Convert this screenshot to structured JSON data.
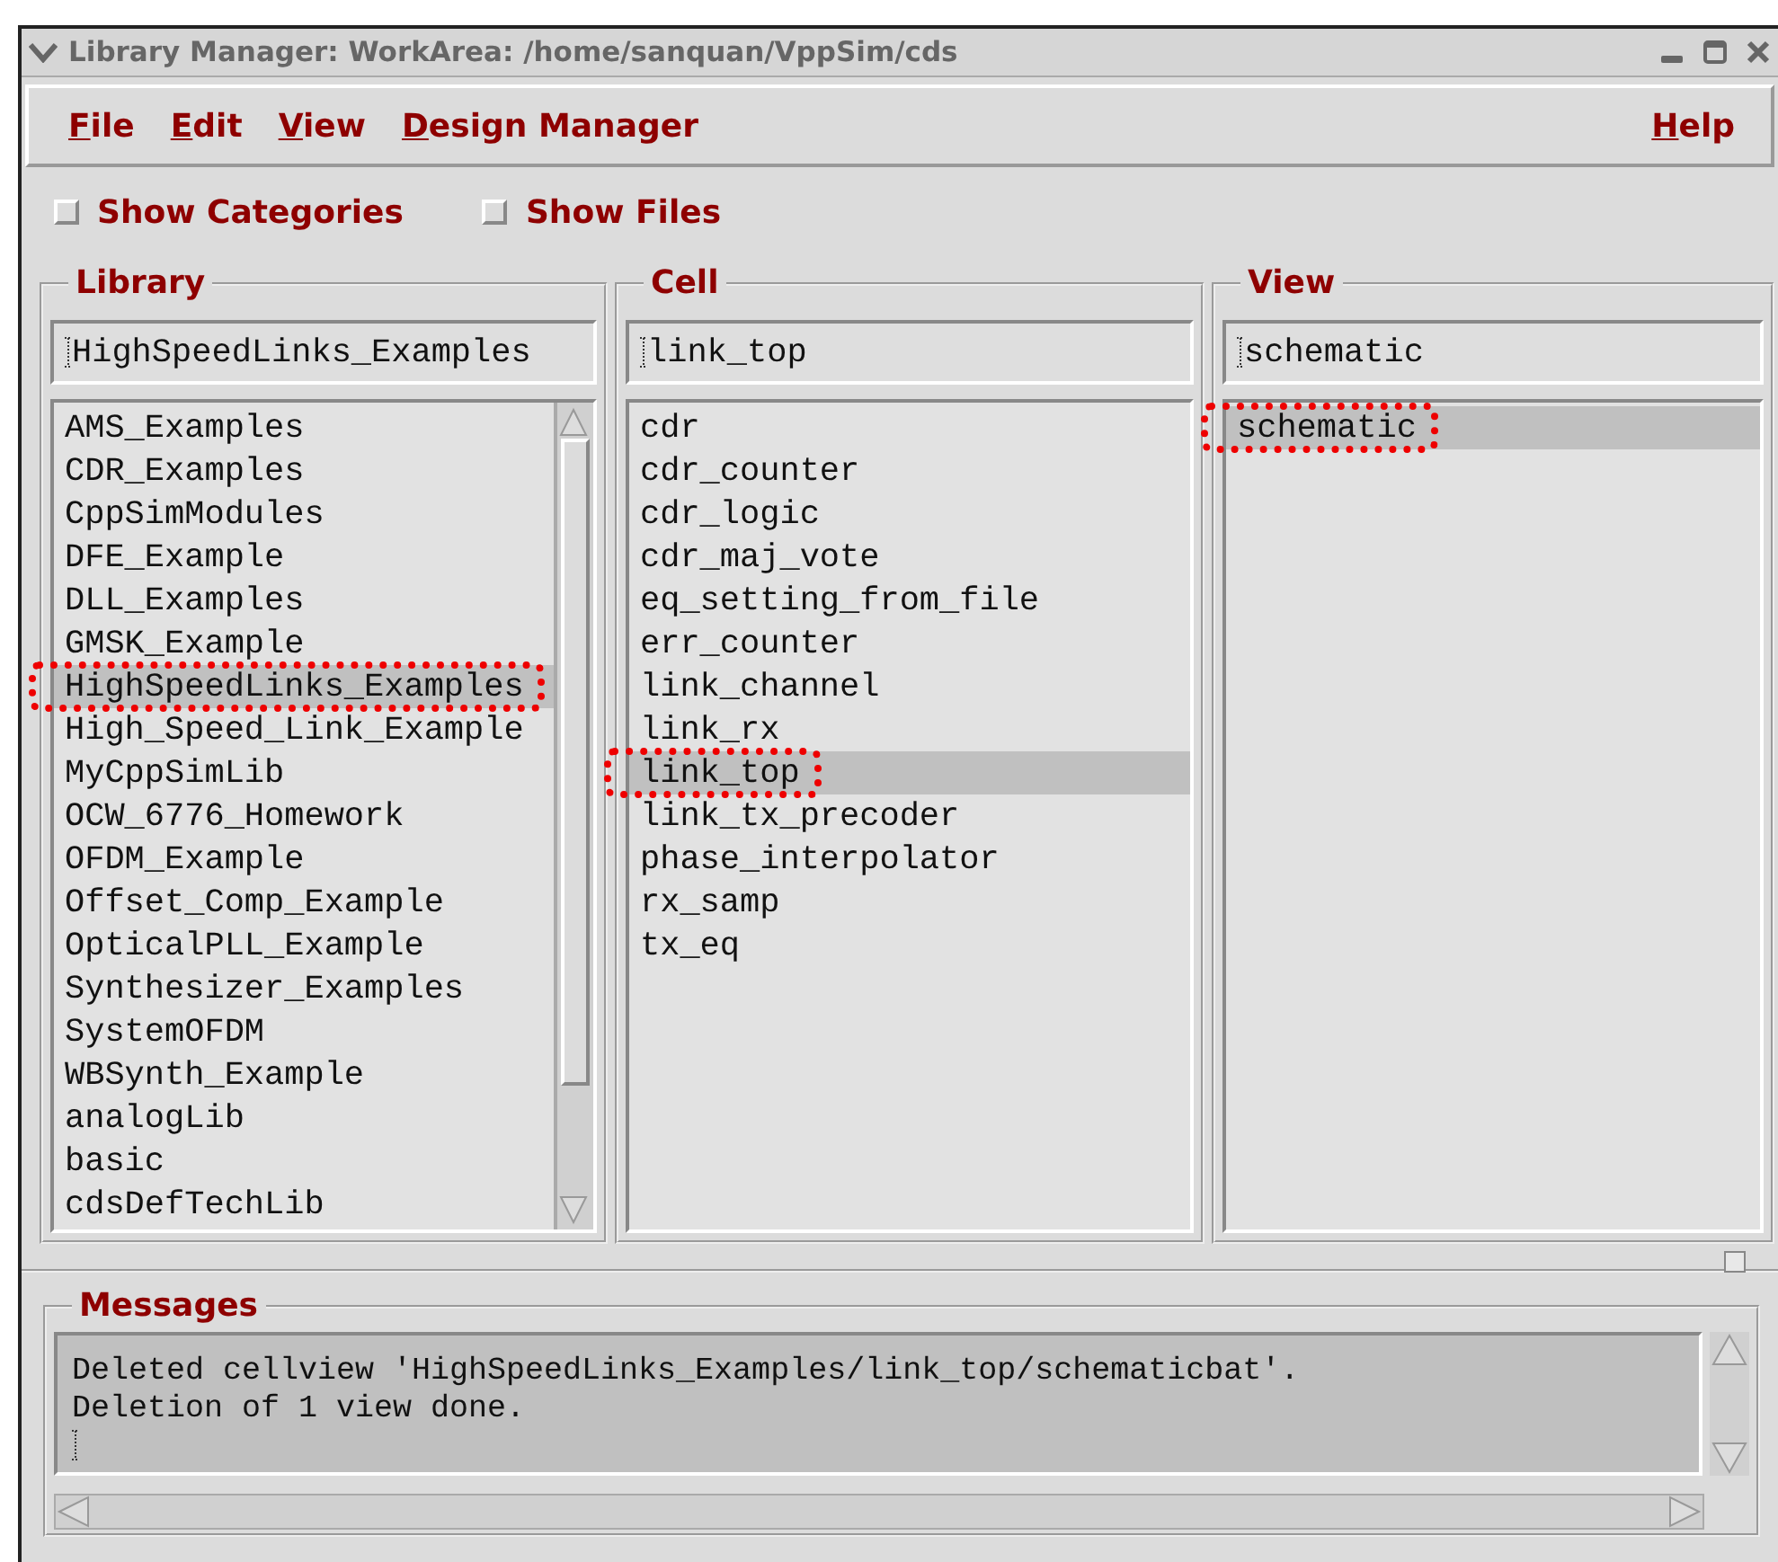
{
  "window": {
    "title": "Library Manager: WorkArea: /home/sanquan/VppSim/cds"
  },
  "menu": [
    {
      "label": "File"
    },
    {
      "label": "Edit"
    },
    {
      "label": "View"
    },
    {
      "label": "Design Manager"
    }
  ],
  "help_menu": {
    "label": "Help"
  },
  "options": [
    {
      "label": "Show Categories",
      "checked": false
    },
    {
      "label": "Show Files",
      "checked": false
    }
  ],
  "columns": [
    {
      "title": "Library",
      "value": "HighSpeedLinks_Examples",
      "scrollbar": true,
      "items": [
        {
          "label": "AMS_Examples",
          "selected": false,
          "annotated": false
        },
        {
          "label": "CDR_Examples",
          "selected": false,
          "annotated": false
        },
        {
          "label": "CppSimModules",
          "selected": false,
          "annotated": false
        },
        {
          "label": "DFE_Example",
          "selected": false,
          "annotated": false
        },
        {
          "label": "DLL_Examples",
          "selected": false,
          "annotated": false
        },
        {
          "label": "GMSK_Example",
          "selected": false,
          "annotated": false
        },
        {
          "label": "HighSpeedLinks_Examples",
          "selected": true,
          "annotated": true
        },
        {
          "label": "High_Speed_Link_Example",
          "selected": false,
          "annotated": false
        },
        {
          "label": "MyCppSimLib",
          "selected": false,
          "annotated": false
        },
        {
          "label": "OCW_6776_Homework",
          "selected": false,
          "annotated": false
        },
        {
          "label": "OFDM_Example",
          "selected": false,
          "annotated": false
        },
        {
          "label": "Offset_Comp_Example",
          "selected": false,
          "annotated": false
        },
        {
          "label": "OpticalPLL_Example",
          "selected": false,
          "annotated": false
        },
        {
          "label": "Synthesizer_Examples",
          "selected": false,
          "annotated": false
        },
        {
          "label": "SystemOFDM",
          "selected": false,
          "annotated": false
        },
        {
          "label": "WBSynth_Example",
          "selected": false,
          "annotated": false
        },
        {
          "label": "analogLib",
          "selected": false,
          "annotated": false
        },
        {
          "label": "basic",
          "selected": false,
          "annotated": false
        },
        {
          "label": "cdsDefTechLib",
          "selected": false,
          "annotated": false
        }
      ]
    },
    {
      "title": "Cell",
      "value": "link_top",
      "scrollbar": false,
      "items": [
        {
          "label": "cdr",
          "selected": false,
          "annotated": false
        },
        {
          "label": "cdr_counter",
          "selected": false,
          "annotated": false
        },
        {
          "label": "cdr_logic",
          "selected": false,
          "annotated": false
        },
        {
          "label": "cdr_maj_vote",
          "selected": false,
          "annotated": false
        },
        {
          "label": "eq_setting_from_file",
          "selected": false,
          "annotated": false
        },
        {
          "label": "err_counter",
          "selected": false,
          "annotated": false
        },
        {
          "label": "link_channel",
          "selected": false,
          "annotated": false
        },
        {
          "label": "link_rx",
          "selected": false,
          "annotated": false
        },
        {
          "label": "link_top",
          "selected": true,
          "annotated": true
        },
        {
          "label": "link_tx_precoder",
          "selected": false,
          "annotated": false
        },
        {
          "label": "phase_interpolator",
          "selected": false,
          "annotated": false
        },
        {
          "label": "rx_samp",
          "selected": false,
          "annotated": false
        },
        {
          "label": "tx_eq",
          "selected": false,
          "annotated": false
        }
      ]
    },
    {
      "title": "View",
      "value": "schematic",
      "scrollbar": false,
      "items": [
        {
          "label": "schematic",
          "selected": true,
          "annotated": true
        }
      ]
    }
  ],
  "messages": {
    "title": "Messages",
    "lines": [
      "Deleted cellview 'HighSpeedLinks_Examples/link_top/schematicbat'.",
      "Deletion of 1 view done."
    ]
  }
}
